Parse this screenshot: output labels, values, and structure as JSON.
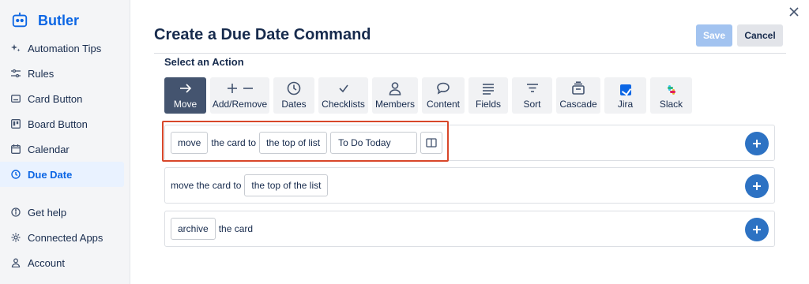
{
  "app": {
    "name": "Butler"
  },
  "sidebar": {
    "items": [
      {
        "label": "Automation Tips",
        "icon": "sparkle-icon"
      },
      {
        "label": "Rules",
        "icon": "sliders-icon"
      },
      {
        "label": "Card Button",
        "icon": "card-button-icon"
      },
      {
        "label": "Board Button",
        "icon": "board-button-icon"
      },
      {
        "label": "Calendar",
        "icon": "calendar-icon"
      },
      {
        "label": "Due Date",
        "icon": "clock-icon",
        "active": true
      }
    ],
    "footer_items": [
      {
        "label": "Get help",
        "icon": "info-icon"
      },
      {
        "label": "Connected Apps",
        "icon": "gear-icon"
      },
      {
        "label": "Account",
        "icon": "person-icon"
      }
    ]
  },
  "header": {
    "title": "Create a Due Date Command",
    "save_label": "Save",
    "cancel_label": "Cancel"
  },
  "actions": {
    "section_label": "Select an Action",
    "tools": [
      {
        "label": "Move",
        "icon": "arrow-right-icon",
        "active": true
      },
      {
        "label": "Add/Remove",
        "icon": "plus-minus-icon"
      },
      {
        "label": "Dates",
        "icon": "clock-icon"
      },
      {
        "label": "Checklists",
        "icon": "check-icon"
      },
      {
        "label": "Members",
        "icon": "person-icon"
      },
      {
        "label": "Content",
        "icon": "speech-bubble-icon"
      },
      {
        "label": "Fields",
        "icon": "fields-icon"
      },
      {
        "label": "Sort",
        "icon": "sort-icon"
      },
      {
        "label": "Cascade",
        "icon": "cascade-icon"
      },
      {
        "label": "Jira",
        "icon": "jira-logo-icon"
      },
      {
        "label": "Slack",
        "icon": "slack-logo-icon"
      }
    ]
  },
  "rows": {
    "row1": {
      "verb": "move",
      "text": "the card to",
      "position": "the top of list",
      "list_value": "To Do Today"
    },
    "row2": {
      "text": "move the card to",
      "position": "the top of the list"
    },
    "row3": {
      "verb": "archive",
      "text": "the card"
    }
  },
  "colors": {
    "accent": "#0c66e4",
    "active_tool": "#44546f",
    "add_button": "#2d72c3",
    "highlight": "#d8472a",
    "save_disabled": "#a2c3f0"
  }
}
